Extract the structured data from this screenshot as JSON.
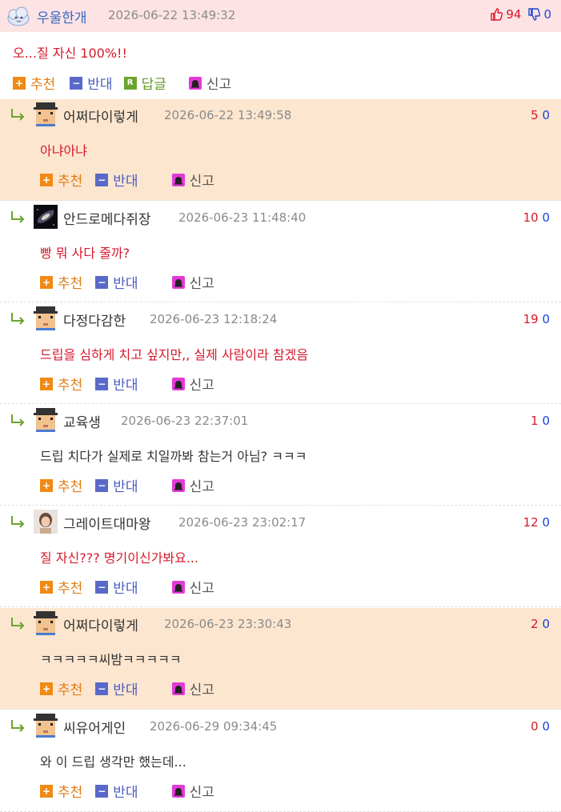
{
  "main": {
    "nickname": "우울한개",
    "date": "2026-06-22 13:49:32",
    "up": "94",
    "down": "0",
    "body": "오...질 자신 100%!!",
    "actions": {
      "up": "추천",
      "down": "반대",
      "reply": "답글",
      "report": "신고"
    }
  },
  "replies": [
    {
      "nickname": "어쩌다이렇게",
      "date": "2026-06-22 13:49:58",
      "up": "5",
      "down": "0",
      "body": "아냐아냐",
      "avatar": "pixel-face-icon",
      "highlight": true,
      "body_color": "red"
    },
    {
      "nickname": "안드로메다쥐장",
      "date": "2026-06-23 11:48:40",
      "up": "10",
      "down": "0",
      "body": "빵 뭐 사다 줄까?",
      "avatar": "galaxy-icon",
      "highlight": false,
      "body_color": "red"
    },
    {
      "nickname": "다정다감한",
      "date": "2026-06-23 12:18:24",
      "up": "19",
      "down": "0",
      "body": "드립을 심하게 치고 싶지만,, 실제 사람이라 참겠음",
      "avatar": "pixel-face-icon",
      "highlight": false,
      "body_color": "red"
    },
    {
      "nickname": "교육생",
      "date": "2026-06-23 22:37:01",
      "up": "1",
      "down": "0",
      "body": "드립 치다가 실제로 치일까봐 참는거 아님? ㅋㅋㅋ",
      "avatar": "pixel-face-icon",
      "highlight": false,
      "body_color": "dark"
    },
    {
      "nickname": "그레이트대마왕",
      "date": "2026-06-23 23:02:17",
      "up": "12",
      "down": "0",
      "body": "질 자신??? 명기이신가봐요...",
      "avatar": "photo-avatar-icon",
      "highlight": false,
      "body_color": "red"
    },
    {
      "nickname": "어쩌다이렇게",
      "date": "2026-06-23 23:30:43",
      "up": "2",
      "down": "0",
      "body": "ㅋㅋㅋㅋㅋ씨밤ㅋㅋㅋㅋㅋ",
      "avatar": "pixel-face-icon",
      "highlight": true,
      "body_color": "dark"
    },
    {
      "nickname": "씨유어게인",
      "date": "2026-06-29 09:34:45",
      "up": "0",
      "down": "0",
      "body": "와 이 드립 생각만 했는데...",
      "avatar": "pixel-face-icon",
      "highlight": false,
      "body_color": "dark"
    }
  ],
  "reply_actions": {
    "up": "추천",
    "down": "반대",
    "report": "신고"
  },
  "colors": {
    "highlight_bg": "#fde6cf",
    "main_head_bg": "#fde3e4",
    "up": "#d6192b",
    "down": "#1a46d6"
  }
}
